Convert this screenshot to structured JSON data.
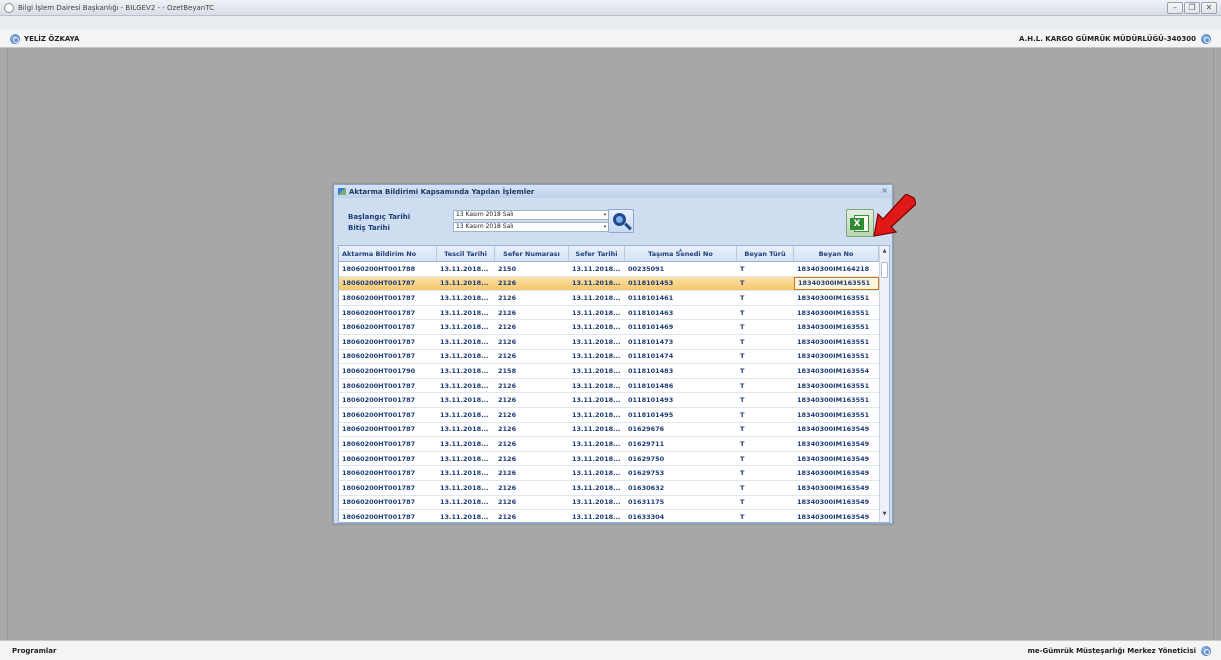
{
  "window": {
    "title": "Bilgi İşlem Dairesi Başkanlığı - BILGEV2 - - OzetBeyanTC"
  },
  "header": {
    "user": "YELİZ ÖZKAYA",
    "office": "A.H.L. KARGO GÜMRÜK MÜDÜRLÜĞÜ-340300"
  },
  "footer": {
    "programs": "Programlar",
    "role": "me-Gümrük Müsteşarlığı Merkez Yöneticisi"
  },
  "dialog": {
    "title": "Aktarma Bildirimi Kapsamında Yapılan İşlemler",
    "start_label": "Başlangıç Tarihi",
    "end_label": "Bitiş Tarihi",
    "start_value": "13 Kasım 2018 Salı",
    "end_value": "13 Kasım 2018 Salı"
  },
  "grid": {
    "columns": [
      "Aktarma Bildirim No",
      "Tescil Tarihi",
      "Sefer Numarası",
      "Sefer Tarihi",
      "Taşıma Senedi No",
      "Beyan Türü",
      "Beyan No"
    ],
    "rows": [
      [
        "18060200HT001788",
        "13.11.2018...",
        "2150",
        "13.11.2018...",
        "00235091",
        "T",
        "18340300IM164218"
      ],
      [
        "18060200HT001787",
        "13.11.2018...",
        "2126",
        "13.11.2018...",
        "0118101453",
        "T",
        "18340300IM163551"
      ],
      [
        "18060200HT001787",
        "13.11.2018...",
        "2126",
        "13.11.2018...",
        "0118101461",
        "T",
        "18340300IM163551"
      ],
      [
        "18060200HT001787",
        "13.11.2018...",
        "2126",
        "13.11.2018...",
        "0118101463",
        "T",
        "18340300IM163551"
      ],
      [
        "18060200HT001787",
        "13.11.2018...",
        "2126",
        "13.11.2018...",
        "0118101469",
        "T",
        "18340300IM163551"
      ],
      [
        "18060200HT001787",
        "13.11.2018...",
        "2126",
        "13.11.2018...",
        "0118101473",
        "T",
        "18340300IM163551"
      ],
      [
        "18060200HT001787",
        "13.11.2018...",
        "2126",
        "13.11.2018...",
        "0118101474",
        "T",
        "18340300IM163551"
      ],
      [
        "18060200HT001790",
        "13.11.2018...",
        "2158",
        "13.11.2018...",
        "0118101483",
        "T",
        "18340300IM163554"
      ],
      [
        "18060200HT001787",
        "13.11.2018...",
        "2126",
        "13.11.2018...",
        "0118101486",
        "T",
        "18340300IM163551"
      ],
      [
        "18060200HT001787",
        "13.11.2018...",
        "2126",
        "13.11.2018...",
        "0118101493",
        "T",
        "18340300IM163551"
      ],
      [
        "18060200HT001787",
        "13.11.2018...",
        "2126",
        "13.11.2018...",
        "0118101495",
        "T",
        "18340300IM163551"
      ],
      [
        "18060200HT001787",
        "13.11.2018...",
        "2126",
        "13.11.2018...",
        "01629676",
        "T",
        "18340300IM163549"
      ],
      [
        "18060200HT001787",
        "13.11.2018...",
        "2126",
        "13.11.2018...",
        "01629711",
        "T",
        "18340300IM163549"
      ],
      [
        "18060200HT001787",
        "13.11.2018...",
        "2126",
        "13.11.2018...",
        "01629750",
        "T",
        "18340300IM163549"
      ],
      [
        "18060200HT001787",
        "13.11.2018...",
        "2126",
        "13.11.2018...",
        "01629753",
        "T",
        "18340300IM163549"
      ],
      [
        "18060200HT001787",
        "13.11.2018...",
        "2126",
        "13.11.2018...",
        "01630632",
        "T",
        "18340300IM163549"
      ],
      [
        "18060200HT001787",
        "13.11.2018...",
        "2126",
        "13.11.2018...",
        "01631175",
        "T",
        "18340300IM163549"
      ],
      [
        "18060200HT001787",
        "13.11.2018...",
        "2126",
        "13.11.2018...",
        "01633304",
        "T",
        "18340300IM163549"
      ]
    ]
  },
  "colors": {
    "selected_row": "#f6c86c",
    "accent": "#1e3f7a",
    "annotation_arrow": "#e01818"
  }
}
